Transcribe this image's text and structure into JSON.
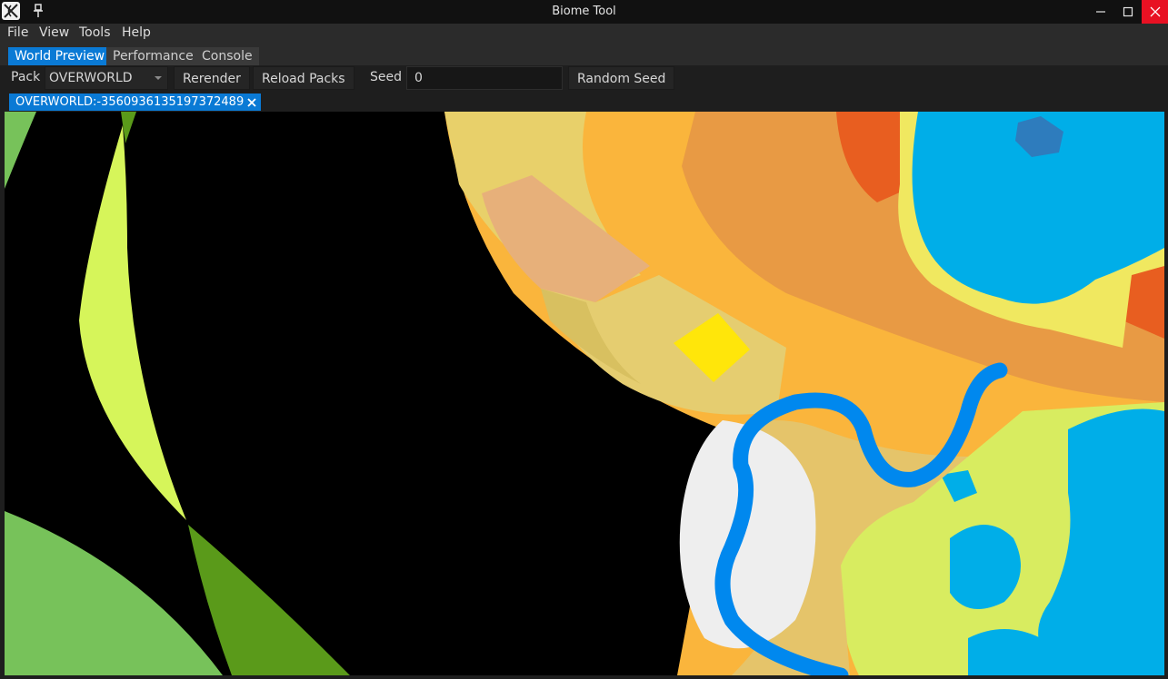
{
  "window": {
    "title": "Biome Tool",
    "icons": {
      "app": "app-logo-icon",
      "pin": "pin-icon",
      "minimize": "minimize-icon",
      "maximize": "maximize-icon",
      "close": "close-icon"
    }
  },
  "menu": [
    "File",
    "View",
    "Tools",
    "Help"
  ],
  "tabs": [
    {
      "label": "World Preview",
      "active": true
    },
    {
      "label": "Performance",
      "active": false
    },
    {
      "label": "Console",
      "active": false
    }
  ],
  "toolbar": {
    "pack_label": "Pack",
    "pack_value": "OVERWORLD",
    "rerender_label": "Rerender",
    "reload_packs_label": "Reload Packs",
    "seed_label": "Seed",
    "seed_value": "0",
    "random_seed_label": "Random Seed"
  },
  "document_tab": {
    "label": "OVERWORLD:-3560936135197372489",
    "close_icon": "close-icon"
  },
  "colors": {
    "accent": "#0a7ad5",
    "close_red": "#e81123",
    "biome_black": "#000000",
    "biome_lime": "#d6f55a",
    "biome_green": "#77c25a",
    "biome_dark_green": "#5a9a1a",
    "biome_sand": "#e8d06a",
    "biome_tan": "#e7b07a",
    "biome_orange": "#fab53c",
    "biome_dark_orange": "#e89a44",
    "biome_red_orange": "#e85e20",
    "biome_ocean": "#00aee8",
    "biome_deep_ocean": "#2e7cbd",
    "biome_yellow": "#f0e860",
    "biome_pale_yellow": "#d8ec60",
    "biome_river": "#0088ee",
    "biome_snow": "#eeeeee",
    "biome_bright_yellow": "#ffe60a"
  }
}
